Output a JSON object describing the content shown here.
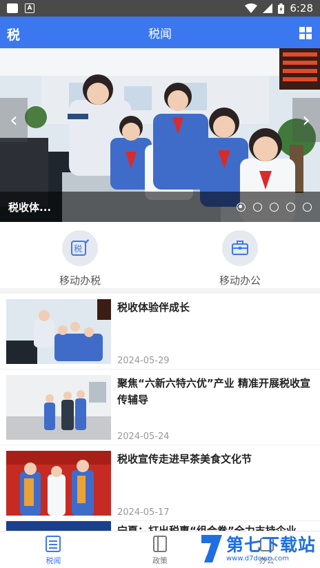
{
  "status_bar": {
    "time": "6:28"
  },
  "header": {
    "title": "税闻",
    "logo_text": "税",
    "logo_icon": "tax-logo-icon",
    "menu_icon": "grid-menu-icon"
  },
  "carousel": {
    "caption": "税收体...",
    "slide_count": 5,
    "active_index": 0
  },
  "quick_actions": [
    {
      "label": "移动办税",
      "icon": "tax-pen-icon"
    },
    {
      "label": "移动办公",
      "icon": "briefcase-icon"
    }
  ],
  "news": [
    {
      "title": "税收体验伴成长",
      "date": "2024-05-29"
    },
    {
      "title": "聚焦“六新六特六优”产业 精准开展税收宣传辅导",
      "date": "2024-05-24"
    },
    {
      "title": "税收宣传走进早茶美食文化节",
      "date": "2024-05-17"
    }
  ],
  "news_partial": {
    "title": "宁夏：打出税惠“组合拳”全力支持企业"
  },
  "bottom_nav": [
    {
      "label": "税闻",
      "icon": "news-icon",
      "active": true
    },
    {
      "label": "政策",
      "icon": "policy-book-icon",
      "active": false
    },
    {
      "label": "办公",
      "icon": "office-icon",
      "active": false
    }
  ],
  "watermark": {
    "big": "第七下载站",
    "small": "www.d7down.com"
  },
  "colors": {
    "accent": "#3b78f0",
    "status_bar": "#4a4a4a"
  }
}
